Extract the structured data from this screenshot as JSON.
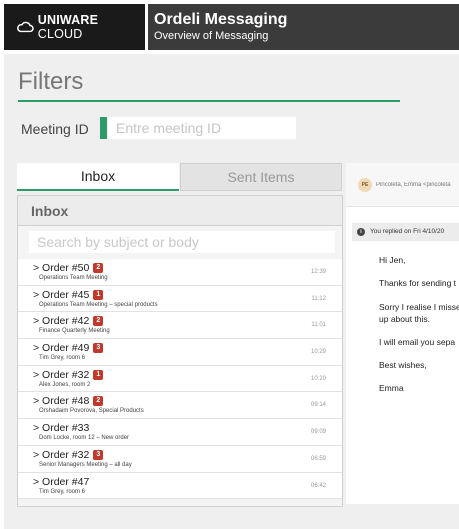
{
  "header": {
    "brand": "UNIWARE",
    "brand_suffix": "CLOUD",
    "app_title": "Ordeli Messaging",
    "app_subtitle": "Overview of Messaging"
  },
  "filters": {
    "title": "Filters",
    "meeting_id_label": "Meeting ID",
    "meeting_id_placeholder": "Entre meeting ID",
    "meeting_id_value": ""
  },
  "tabs": [
    {
      "label": "Inbox",
      "active": true
    },
    {
      "label": "Sent Items",
      "active": false
    }
  ],
  "inbox": {
    "heading": "Inbox",
    "search_placeholder": "Search by subject or body",
    "rows": [
      {
        "subject": "> Order #50",
        "badge": "2",
        "desc": "Operations Team Meeting",
        "time": "12:39"
      },
      {
        "subject": "> Order #45",
        "badge": "1",
        "desc": "Operations Team Meeting – special products",
        "time": "11:12"
      },
      {
        "subject": "> Order #42",
        "badge": "2",
        "desc": "Finance Quarterly Meeting",
        "time": "11:01"
      },
      {
        "subject": "> Order #49",
        "badge": "3",
        "desc": "Tim Grey, room 6",
        "time": "10:29"
      },
      {
        "subject": "> Order #32",
        "badge": "1",
        "desc": "Alex Jones, room 2",
        "time": "10:20"
      },
      {
        "subject": "> Order #48",
        "badge": "2",
        "desc": "Orshadaim Povorova, Special Products",
        "time": "09:14"
      },
      {
        "subject": "> Order #33",
        "badge": "",
        "desc": "Dom Locke, room 12 – New order",
        "time": "09:09"
      },
      {
        "subject": "> Order #32",
        "badge": "3",
        "desc": "Senior Managers Meeting – all day",
        "time": "06:59"
      },
      {
        "subject": "> Order #47",
        "badge": "",
        "desc": "Tim Grey, room 6",
        "time": "06:42"
      }
    ]
  },
  "message": {
    "avatar_initials": "PE",
    "from": "Pincoleta, Emma <pincoleta",
    "replied": "You replied on Fri 4/10/20",
    "body": {
      "greeting": "Hi Jen,",
      "line1": "Thanks for sending t",
      "line2": "Sorry I realise I misse",
      "line3": "up about this.",
      "line4": "I will email you sepa",
      "signoff": "Best wishes,",
      "name": "Emma"
    }
  },
  "colors": {
    "accent": "#2e9c6a",
    "badge": "#c0392b",
    "header_dark": "#1a1a1a",
    "title_bar": "#3b3b3b"
  }
}
